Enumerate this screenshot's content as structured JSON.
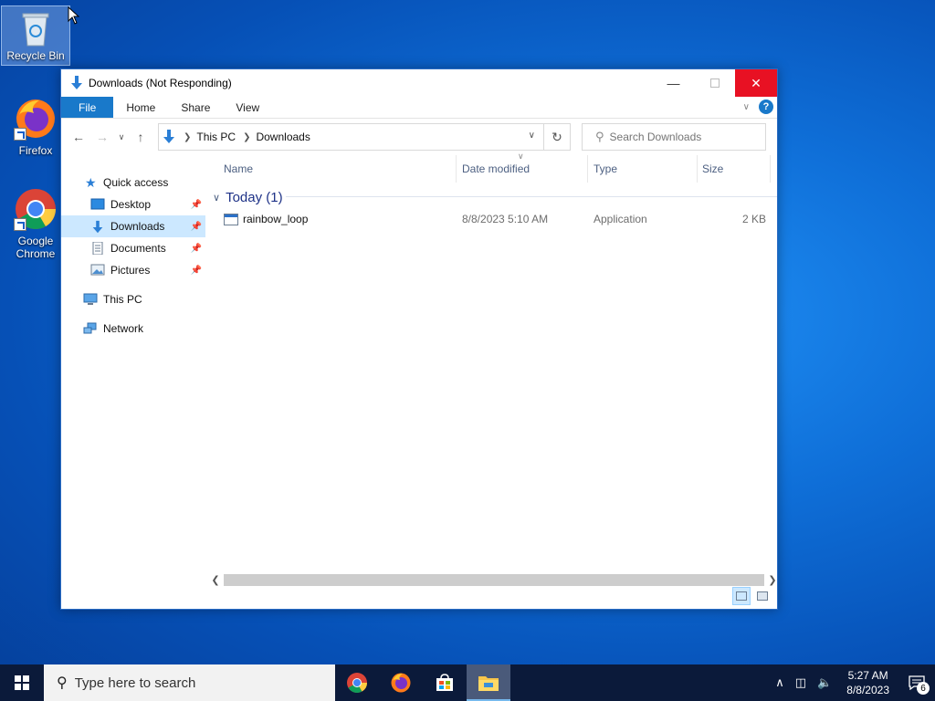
{
  "desktop": {
    "icons": [
      {
        "label": "Recycle Bin"
      },
      {
        "label": "Firefox"
      },
      {
        "label": "Google Chrome"
      }
    ]
  },
  "window": {
    "title": "Downloads (Not Responding)",
    "ribbon_tabs": [
      "File",
      "Home",
      "Share",
      "View"
    ],
    "help": "?",
    "address": {
      "crumbs": [
        "This PC",
        "Downloads"
      ]
    },
    "search_placeholder": "Search Downloads",
    "sidebar": {
      "quick_access": "Quick access",
      "items": [
        {
          "label": "Desktop",
          "pinned": true
        },
        {
          "label": "Downloads",
          "pinned": true,
          "active": true
        },
        {
          "label": "Documents",
          "pinned": true
        },
        {
          "label": "Pictures",
          "pinned": true
        }
      ],
      "this_pc": "This PC",
      "network": "Network"
    },
    "columns": [
      "Name",
      "Date modified",
      "Type",
      "Size"
    ],
    "group": "Today (1)",
    "files": [
      {
        "name": "rainbow_loop",
        "date": "8/8/2023 5:10 AM",
        "type": "Application",
        "size": "2 KB"
      }
    ]
  },
  "taskbar": {
    "search_placeholder": "Type here to search",
    "time": "5:27 AM",
    "date": "8/8/2023",
    "notification_count": "6"
  }
}
